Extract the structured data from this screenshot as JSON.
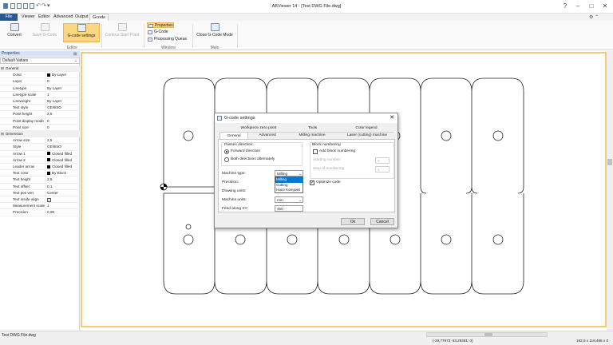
{
  "window": {
    "title": "ABViewer 14 - [Test DWG File.dwg]"
  },
  "menu": {
    "file": "File",
    "items": [
      "Viewer",
      "Editor",
      "Advanced",
      "Output",
      "Gcode"
    ]
  },
  "ribbon": {
    "convert": "Convert",
    "save_gcode": "Save G-Code",
    "gcode_settings": "G-code settings",
    "contour_start_point": "Contour Start Point",
    "properties": "Properties",
    "gcode": "G-Code",
    "processing_queue": "Processing Queue",
    "close_gcode_mode": "Close G-Code Mode",
    "group_editor": "Editor",
    "group_window": "Window",
    "group_main": "Main"
  },
  "properties_panel": {
    "title": "Properties",
    "selector": "Default Values",
    "rows": [
      {
        "cat": true,
        "label": "General"
      },
      {
        "label": "Color",
        "value": "By Layer",
        "swatch": "#000000"
      },
      {
        "label": "Layer",
        "value": "0"
      },
      {
        "label": "Linetype",
        "value": "By Layer"
      },
      {
        "label": "Linetype scale",
        "value": "1"
      },
      {
        "label": "Lineweight",
        "value": "By Layer"
      },
      {
        "label": "Text style",
        "value": "GENISO"
      },
      {
        "label": "Point height",
        "value": "2,5"
      },
      {
        "label": "Point display mode",
        "value": "0"
      },
      {
        "label": "Point size",
        "value": "0"
      },
      {
        "cat": true,
        "label": "Dimension"
      },
      {
        "label": "Arrow size",
        "value": "2,5"
      },
      {
        "label": "Style",
        "value": "GENISO"
      },
      {
        "label": "Arrow 1",
        "value": "Closed filled",
        "swatch": "#000000"
      },
      {
        "label": "Arrow 2",
        "value": "Closed filled",
        "swatch": "#000000"
      },
      {
        "label": "Leader arrow",
        "value": "Closed filled",
        "swatch": "#000000"
      },
      {
        "label": "Text color",
        "value": "By Block",
        "swatch": "#000000"
      },
      {
        "label": "Text height",
        "value": "2,5"
      },
      {
        "label": "Text offset",
        "value": "0,1"
      },
      {
        "label": "Text pos vert",
        "value": "Center"
      },
      {
        "label": "Text inside align",
        "value": "",
        "check": true
      },
      {
        "label": "Measurement scale",
        "value": "1"
      },
      {
        "label": "Precision",
        "value": "0,00"
      }
    ]
  },
  "dialog": {
    "title": "G-code settings",
    "tabs_top": [
      "Workpiece zero point",
      "Tools",
      "Color legend"
    ],
    "tabs_bottom": [
      "General",
      "Advanced",
      "Milling machine",
      "Laser (cutting) machine"
    ],
    "passes_label": "Passes direction:",
    "forward": "Forward direction",
    "both": "Both directions alternately",
    "block_numbering": "Block numbering",
    "add_block_numbering": "Add block numbering",
    "starting_number_label": "Starting number:",
    "starting_number": "5",
    "step_label": "Step of numbering:",
    "step_value": "5",
    "machine_type_label": "Machine type:",
    "machine_type_value": "Milling",
    "machine_options": [
      "Milling",
      "Cutting",
      "Haco Kompakt"
    ],
    "precision_label": "Precision:",
    "drawing_units_label": "Drawing units:",
    "machine_units_label": "Machine units:",
    "machine_units_value": "mm",
    "feed_label": "Feed along XY:",
    "feed_value": "450",
    "optimize_code": "Optimize code",
    "ok": "Ok",
    "cancel": "Cancel"
  },
  "status": {
    "filename": "Test DWG File.dwg",
    "coords": "(-29,77973; 53,28381; 0)",
    "size": "182,5 x 118,466 x 0"
  },
  "colors": {
    "ribbon_highlight": "#fcd681",
    "accent": "#2b5797",
    "canvas_border": "#f2b84b"
  }
}
